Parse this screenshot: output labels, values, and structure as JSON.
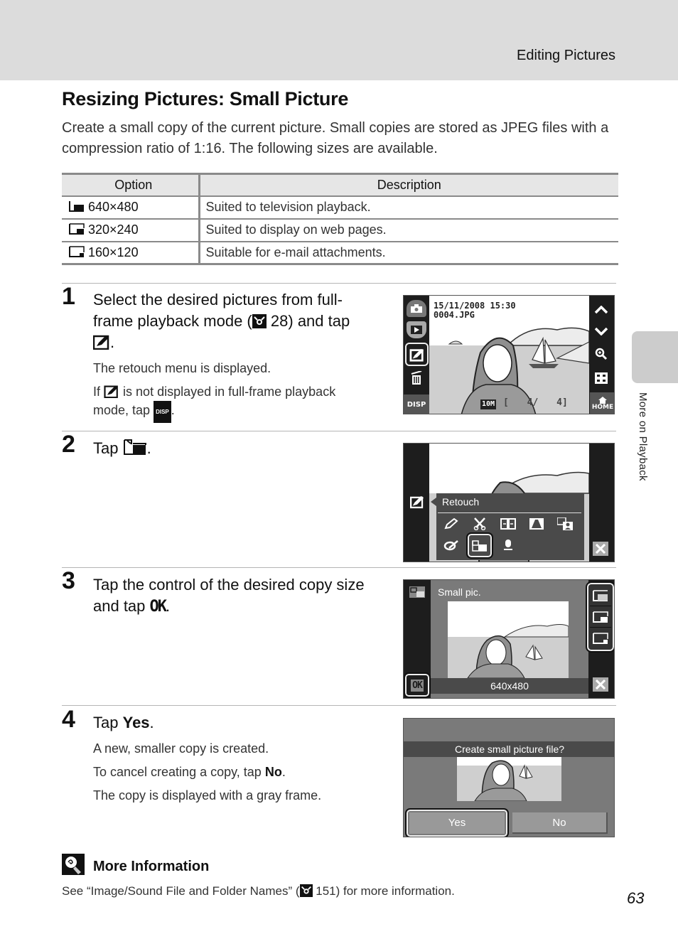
{
  "header": {
    "section": "Editing Pictures"
  },
  "side_tab": {
    "label": "More on Playback"
  },
  "title": "Resizing Pictures: Small Picture",
  "intro": "Create a small copy of the current picture. Small copies are stored as JPEG files with a compression ratio of 1:16. The following sizes are available.",
  "table": {
    "headers": [
      "Option",
      "Description"
    ],
    "rows": [
      {
        "icon": "size-640-icon",
        "option": "640×480",
        "description": "Suited to television playback."
      },
      {
        "icon": "size-320-icon",
        "option": "320×240",
        "description": "Suited to display on web pages."
      },
      {
        "icon": "size-160-icon",
        "option": "160×120",
        "description": "Suitable for e-mail attachments."
      }
    ]
  },
  "steps": [
    {
      "number": "1",
      "head_a": "Select the desired pictures from full-frame playback mode (",
      "head_ref": "28",
      "head_b": ") and tap",
      "head_c": ".",
      "body1": "The retouch menu is displayed.",
      "body2_a": "If",
      "body2_b": "is not displayed in full-frame playback mode, tap",
      "body2_c": ".",
      "screen": {
        "datetime": "15/11/2008 15:30",
        "filename": "0004.JPG",
        "image_mode": "10M",
        "frame_counter": "[ 4/ 4]",
        "disp": "DISP",
        "home": "HOME"
      }
    },
    {
      "number": "2",
      "head_a": "Tap",
      "head_c": ".",
      "screen": {
        "menu_title": "Retouch"
      }
    },
    {
      "number": "3",
      "head": "Tap the control of the desired copy size and tap",
      "head_ok": "OK",
      "head_c": ".",
      "screen": {
        "title": "Small pic.",
        "selected_size": "640x480",
        "ok": "OK"
      }
    },
    {
      "number": "4",
      "head_a": "Tap",
      "head_bold": "Yes",
      "head_c": ".",
      "body1": "A new, smaller copy is created.",
      "body2_a": "To cancel creating a copy, tap",
      "body2_bold": "No",
      "body2_c": ".",
      "body3": "The copy is displayed with a gray frame.",
      "screen": {
        "prompt": "Create small picture file?",
        "yes": "Yes",
        "no": "No"
      }
    }
  ],
  "more_info": {
    "title": "More Information",
    "text_a": "See “Image/Sound File and Folder Names” (",
    "ref": "151",
    "text_b": ") for more information."
  },
  "page_number": "63"
}
